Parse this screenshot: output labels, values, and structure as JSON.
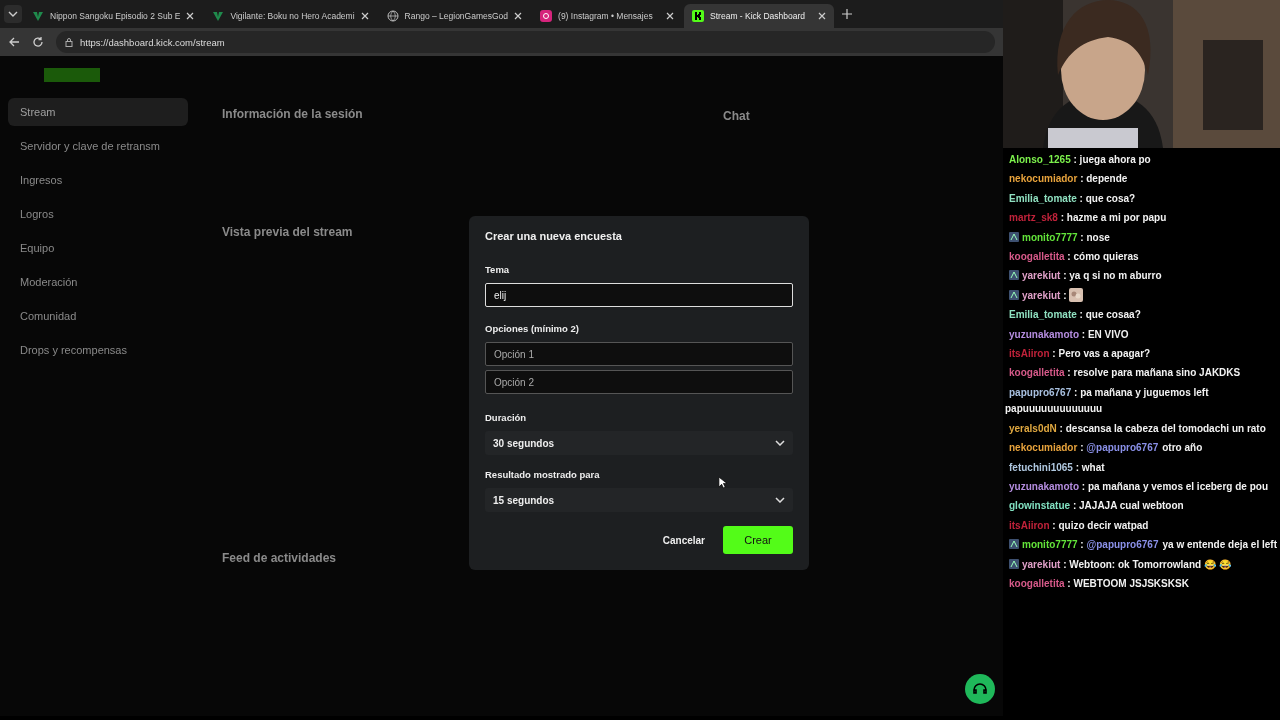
{
  "tabs": [
    {
      "label": "Nippon Sangoku Episodio 2 Sub E",
      "kind": "vtv",
      "selected": false
    },
    {
      "label": "Vigilante: Boku no Hero Academi",
      "kind": "vtv",
      "selected": false
    },
    {
      "label": "Rango – LegionGamesGod",
      "kind": "globe",
      "selected": false
    },
    {
      "label": "(9) Instagram • Mensajes",
      "kind": "instagram",
      "selected": false
    },
    {
      "label": "Stream - Kick Dashboard",
      "kind": "kick",
      "selected": true
    }
  ],
  "chat_separator": ":",
  "address": "https://dashboard.kick.com/stream",
  "dashboard": {
    "sidebar": [
      {
        "label": "Stream",
        "selected": true
      },
      {
        "label": "Servidor y clave de retransm",
        "selected": false
      },
      {
        "label": "Ingresos",
        "selected": false
      },
      {
        "label": "Logros",
        "selected": false
      },
      {
        "label": "Equipo",
        "selected": false
      },
      {
        "label": "Moderación",
        "selected": false
      },
      {
        "label": "Comunidad",
        "selected": false
      },
      {
        "label": "Drops y recompensas",
        "selected": false
      }
    ],
    "sections": [
      "Información de la sesión",
      "Vista previa del stream",
      "Feed de actividades"
    ],
    "chat_title": "Chat"
  },
  "modal": {
    "title": "Crear una nueva encuesta",
    "topic_label": "Tema",
    "topic_value": "elij",
    "options_label": "Opciones (mínimo 2)",
    "options": [
      {
        "placeholder": "Opción 1"
      },
      {
        "placeholder": "Opción 2"
      }
    ],
    "duration_label": "Duración",
    "duration_value": "30 segundos",
    "result_label": "Resultado mostrado para",
    "result_value": "15 segundos",
    "cancel": "Cancelar",
    "create": "Crear"
  },
  "chat": [
    {
      "user": "Alonso_1265",
      "color": "#7cf04c",
      "badge": false,
      "kind": "text",
      "text": "juega ahora po"
    },
    {
      "user": "nekocumiador",
      "color": "#e8a33c",
      "badge": false,
      "kind": "text",
      "text": "depende"
    },
    {
      "user": "Emilia_tomate",
      "color": "#8fe0c0",
      "badge": false,
      "kind": "text",
      "text": "que cosa?"
    },
    {
      "user": "martz_sk8",
      "color": "#c0223a",
      "badge": false,
      "kind": "text",
      "text": "hazme a mi por papu"
    },
    {
      "user": "monito7777",
      "color": "#63e43a",
      "badge": true,
      "kind": "text",
      "text": "nose"
    },
    {
      "user": "koogalletita",
      "color": "#d85a8a",
      "badge": false,
      "kind": "text",
      "text": "cómo quieras"
    },
    {
      "user": "yarekiut",
      "color": "#e0a0c8",
      "badge": true,
      "kind": "text",
      "text": "ya q si no m aburro"
    },
    {
      "user": "yarekiut",
      "color": "#e0a0c8",
      "badge": true,
      "kind": "emote"
    },
    {
      "user": "Emilia_tomate",
      "color": "#8fe0c0",
      "badge": false,
      "kind": "text",
      "text": "que cosaa?"
    },
    {
      "user": "yuzunakamoto",
      "color": "#b58de0",
      "badge": false,
      "kind": "text",
      "text": "EN VIVO"
    },
    {
      "user": "itsAiiron",
      "color": "#c0223a",
      "badge": false,
      "kind": "text",
      "text": "Pero vas a apagar?"
    },
    {
      "user": "koogalletita",
      "color": "#d85a8a",
      "badge": false,
      "kind": "text",
      "text": "resolve para mañana sino JAKDKS"
    },
    {
      "user": "papupro6767",
      "color": "#a8c0e0",
      "badge": false,
      "kind": "text",
      "text": "pa mañana y juguemos left",
      "text_cont": "papuuuuuuuuuuuuu"
    },
    {
      "user": "yerals0dN",
      "color": "#e0a840",
      "badge": false,
      "kind": "text",
      "text": "descansa la cabeza del tomodachi un rato"
    },
    {
      "user": "nekocumiador",
      "color": "#e8a33c",
      "badge": false,
      "kind": "text",
      "mention": "@papupro6767",
      "text": "otro año"
    },
    {
      "user": "fetuchini1065",
      "color": "#b0c8e0",
      "badge": false,
      "kind": "text",
      "text": "what"
    },
    {
      "user": "yuzunakamoto",
      "color": "#b58de0",
      "badge": false,
      "kind": "text",
      "text": "pa mañana y vemos el iceberg de pou"
    },
    {
      "user": "glowinstatue",
      "color": "#80e0c0",
      "badge": false,
      "kind": "text",
      "text": "JAJAJA cual webtoon"
    },
    {
      "user": "itsAiiron",
      "color": "#c0223a",
      "badge": false,
      "kind": "text",
      "text": "quizo decir watpad"
    },
    {
      "user": "monito7777",
      "color": "#63e43a",
      "badge": true,
      "kind": "text",
      "mention": "@papupro6767",
      "text": "ya w entende deja el left"
    },
    {
      "user": "yarekiut",
      "color": "#e0a0c8",
      "badge": true,
      "kind": "text",
      "text": "Webtoon: ok Tomorrowland 😂 😂"
    },
    {
      "user": "koogalletita",
      "color": "#d85a8a",
      "badge": false,
      "kind": "text",
      "text": "WEBTOOM JSJSKSKSK"
    }
  ]
}
